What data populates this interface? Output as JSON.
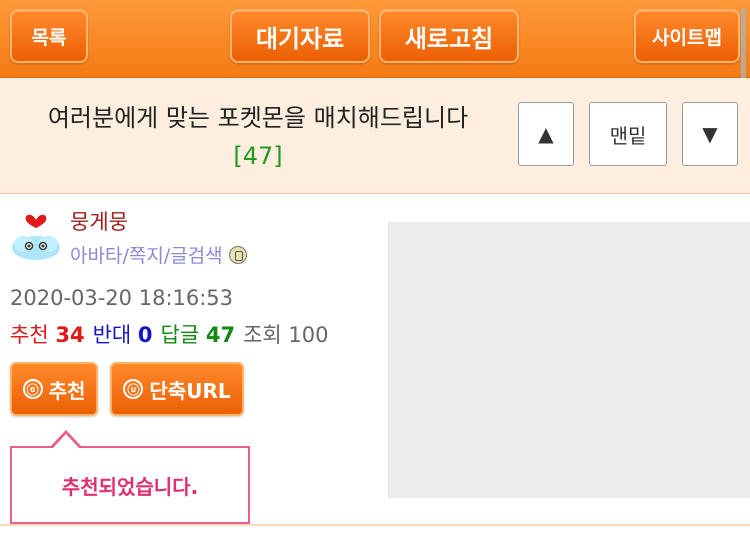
{
  "topbar": {
    "list_label": "목록",
    "pending_label": "대기자료",
    "refresh_label": "새로고침",
    "sitemap_label": "사이트맵"
  },
  "post": {
    "title": "여러분에게 맞는 포켓몬을 매치해드립니다",
    "comment_count": "[47]"
  },
  "nav": {
    "up_label": "▲",
    "bottom_label": "맨밑",
    "down_label": "▼"
  },
  "author": {
    "nickname": "뭉게뭉",
    "links": "아바타/쪽지/글검색",
    "avatar_icon": "heart-cloud-avatar-icon"
  },
  "meta": {
    "datetime": "2020-03-20 18:16:53",
    "recommend_label": "추천",
    "recommend_value": "34",
    "oppose_label": "반대",
    "oppose_value": "0",
    "reply_label": "답글",
    "reply_value": "47",
    "view_label": "조회",
    "view_value": "100"
  },
  "actions": {
    "recommend_icon": "ⓞ",
    "recommend_label": "추천",
    "shorturl_icon": "ⓤ",
    "shorturl_label": "단축URL"
  },
  "tooltip": {
    "message": "추천되었습니다."
  },
  "colors": {
    "accent": "#f47a14",
    "recommend": "#e01818",
    "oppose": "#1414d0",
    "reply": "#128a12",
    "tooltip_border": "#e8608a"
  }
}
